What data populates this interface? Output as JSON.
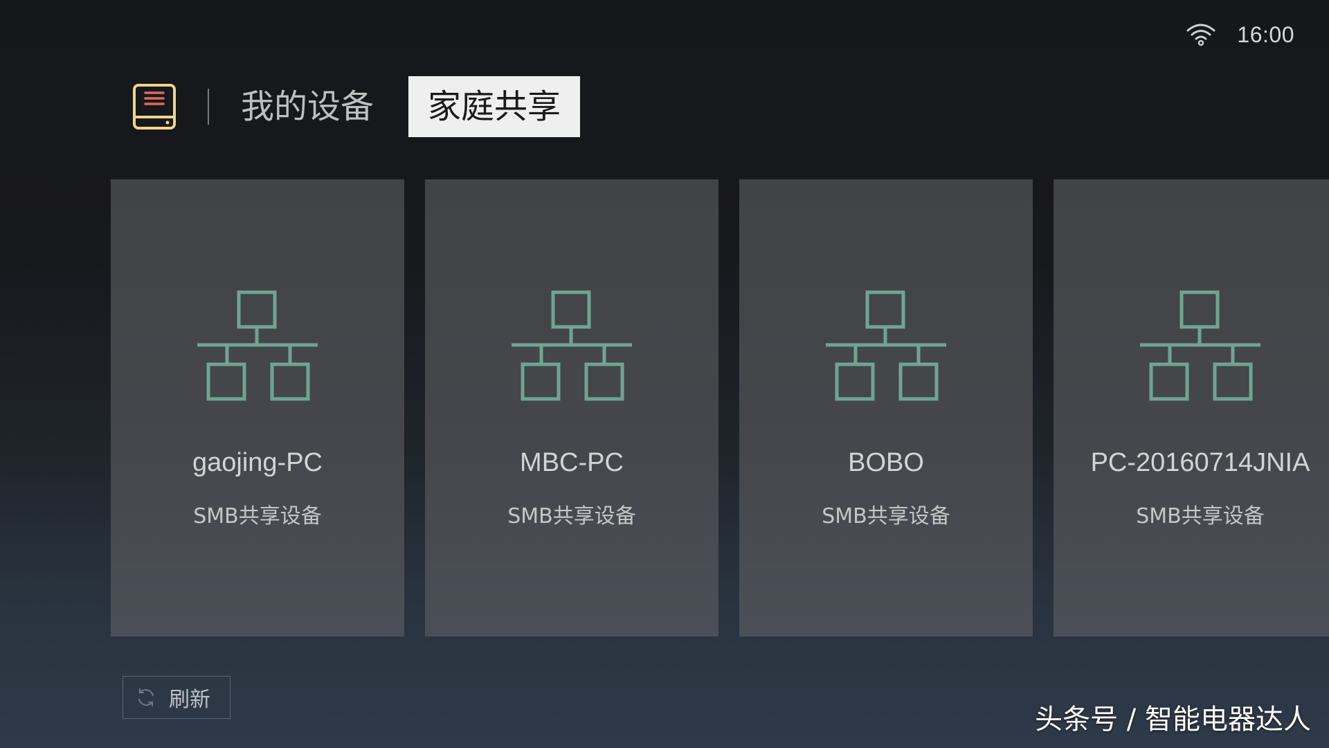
{
  "status_bar": {
    "wifi_icon": "wifi-icon",
    "time": "16:00"
  },
  "header": {
    "app_icon": "hard-drive-icon",
    "tabs": [
      {
        "label": "我的设备",
        "active": false
      },
      {
        "label": "家庭共享",
        "active": true
      }
    ]
  },
  "devices": [
    {
      "name": "gaojing-PC",
      "type": "SMB共享设备",
      "icon": "network-icon"
    },
    {
      "name": "MBC-PC",
      "type": "SMB共享设备",
      "icon": "network-icon"
    },
    {
      "name": "BOBO",
      "type": "SMB共享设备",
      "icon": "network-icon"
    },
    {
      "name": "PC-20160714JNIA",
      "type": "SMB共享设备",
      "icon": "network-icon"
    }
  ],
  "refresh_button": {
    "icon": "refresh-icon",
    "label": "刷新"
  },
  "watermark": "头条号 / 智能电器达人",
  "colors": {
    "icon_green": "#6fa592",
    "drive_yellow": "#f0d48a",
    "drive_red": "#e06a5a",
    "active_tab_bg": "#efefef"
  }
}
